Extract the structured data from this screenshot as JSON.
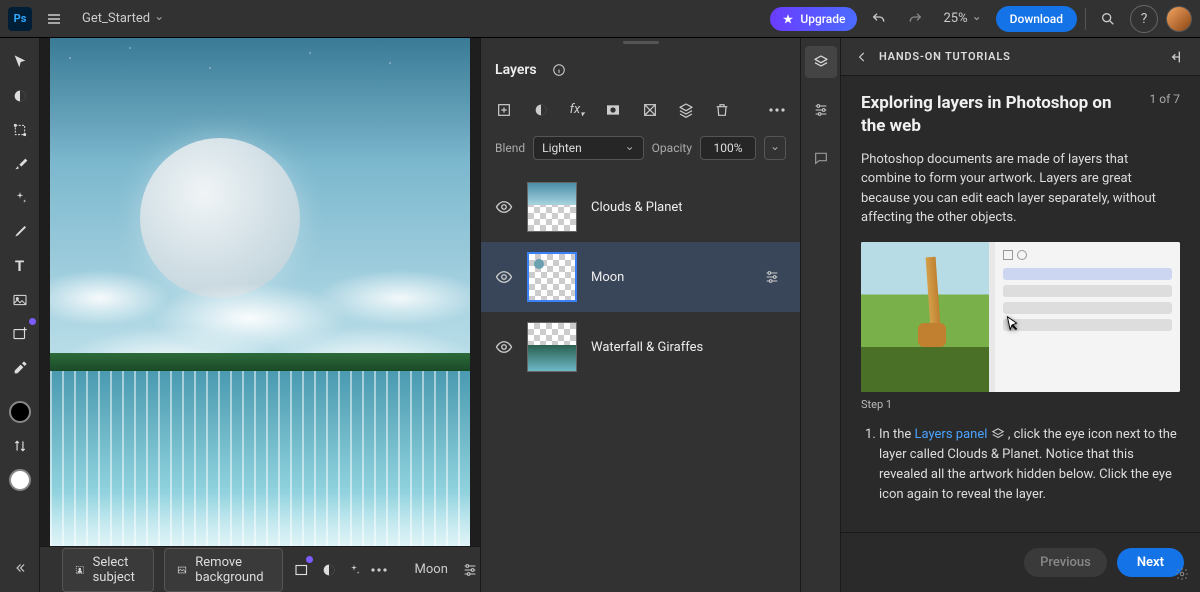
{
  "topbar": {
    "app": "Ps",
    "file_name": "Get_Started",
    "upgrade": "Upgrade",
    "zoom": "25%",
    "download": "Download"
  },
  "tools": [
    {
      "name": "move-tool",
      "glyph": "↖"
    },
    {
      "name": "marquee-tool",
      "glyph": "◑"
    },
    {
      "name": "transform-tool",
      "glyph": "⛶"
    },
    {
      "name": "brush-tool",
      "glyph": "🖌"
    },
    {
      "name": "gen-fill-tool",
      "glyph": "✦"
    },
    {
      "name": "pen-tool",
      "glyph": "✎"
    },
    {
      "name": "type-tool",
      "glyph": "T"
    },
    {
      "name": "image-tool",
      "glyph": "🖼"
    },
    {
      "name": "add-tool",
      "glyph": "➕"
    },
    {
      "name": "eyedropper-tool",
      "glyph": "💧"
    }
  ],
  "layers_panel": {
    "title": "Layers",
    "blend_label": "Blend",
    "blend_value": "Lighten",
    "opacity_label": "Opacity",
    "opacity_value": "100%",
    "layers": [
      {
        "name": "Clouds & Planet",
        "selected": false
      },
      {
        "name": "Moon",
        "selected": true
      },
      {
        "name": "Waterfall & Giraffes",
        "selected": false
      }
    ]
  },
  "context_bar": {
    "select_subject": "Select subject",
    "remove_bg": "Remove background",
    "layer_label": "Moon"
  },
  "tutorial": {
    "header": "HANDS-ON TUTORIALS",
    "title": "Exploring layers in Photoshop on the web",
    "step_of": "1 of 7",
    "desc": "Photoshop documents are made of layers that combine to form your artwork. Layers are great because you can edit each layer separately, without affecting the other objects.",
    "figure_caption": "Step 1",
    "instruction_prefix": "In the ",
    "instruction_link": "Layers panel",
    "instruction_suffix": " , click the eye icon next to the layer called Clouds & Planet. Notice that this revealed all the artwork hidden below. Click the eye icon again to reveal the layer.",
    "prev": "Previous",
    "next": "Next"
  }
}
